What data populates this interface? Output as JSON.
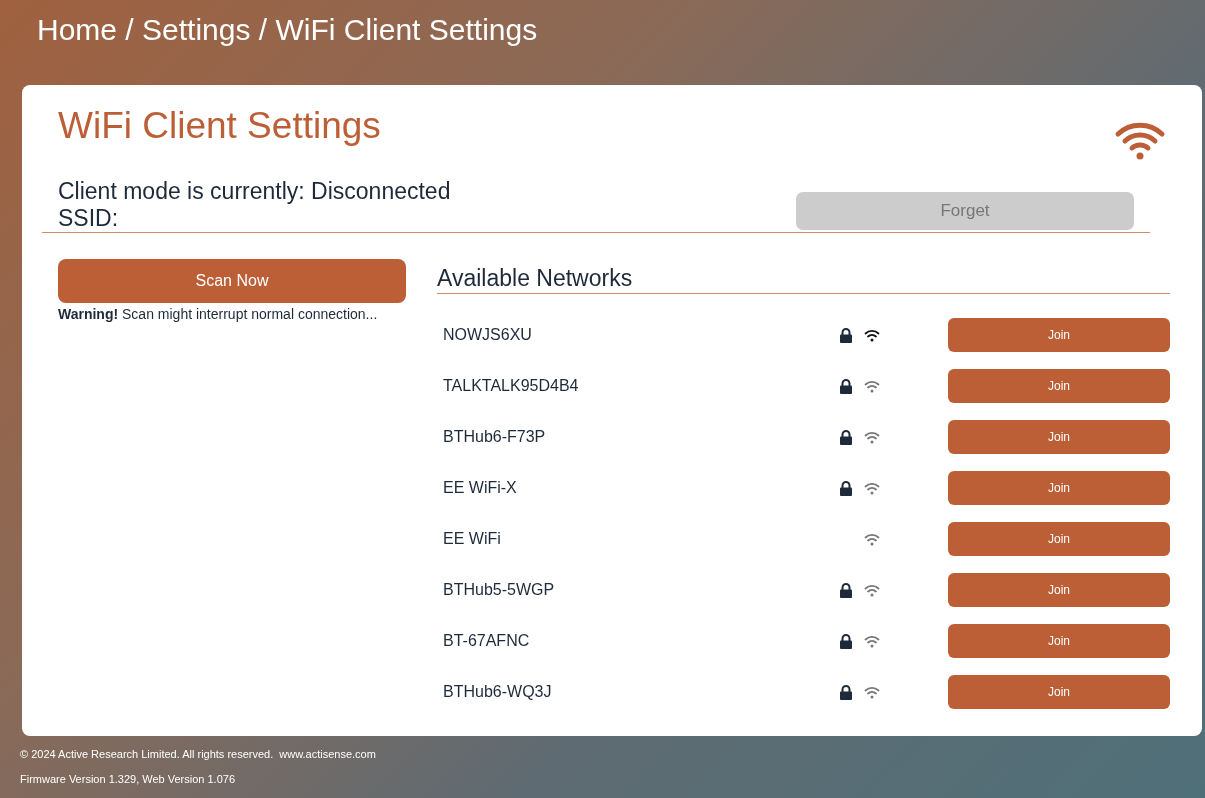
{
  "breadcrumb": "Home / Settings / WiFi Client Settings",
  "page_title": "WiFi Client Settings",
  "status": {
    "mode_text": "Client mode is currently: Disconnected",
    "ssid_text": "SSID:"
  },
  "forget_button": {
    "label": "Forget",
    "disabled": true
  },
  "scan": {
    "button": "Scan Now",
    "warning": "**Warning!** Scan might interrupt normal connection..."
  },
  "networks_title": "Available Networks",
  "networks": [
    {
      "name": "NOWJS6XU",
      "secured": true,
      "strong": true,
      "button": "Join"
    },
    {
      "name": "TALKTALK95D4B4",
      "secured": true,
      "strong": false,
      "button": "Join"
    },
    {
      "name": "BTHub6-F73P",
      "secured": true,
      "strong": false,
      "button": "Join"
    },
    {
      "name": "EE WiFi-X",
      "secured": true,
      "strong": false,
      "button": "Join"
    },
    {
      "name": "EE WiFi",
      "secured": false,
      "strong": false,
      "button": "Join"
    },
    {
      "name": "BTHub5-5WGP",
      "secured": true,
      "strong": false,
      "button": "Join"
    },
    {
      "name": "BT-67AFNC",
      "secured": true,
      "strong": false,
      "button": "Join"
    },
    {
      "name": "BTHub6-WQ3J",
      "secured": true,
      "strong": false,
      "button": "Join"
    }
  ],
  "footer": {
    "copyright": "© 2024 Active Research Limited. All rights reserved.",
    "link": "www.actisense.com",
    "versions": "Firmware Version 1.329, Web Version 1.076"
  }
}
